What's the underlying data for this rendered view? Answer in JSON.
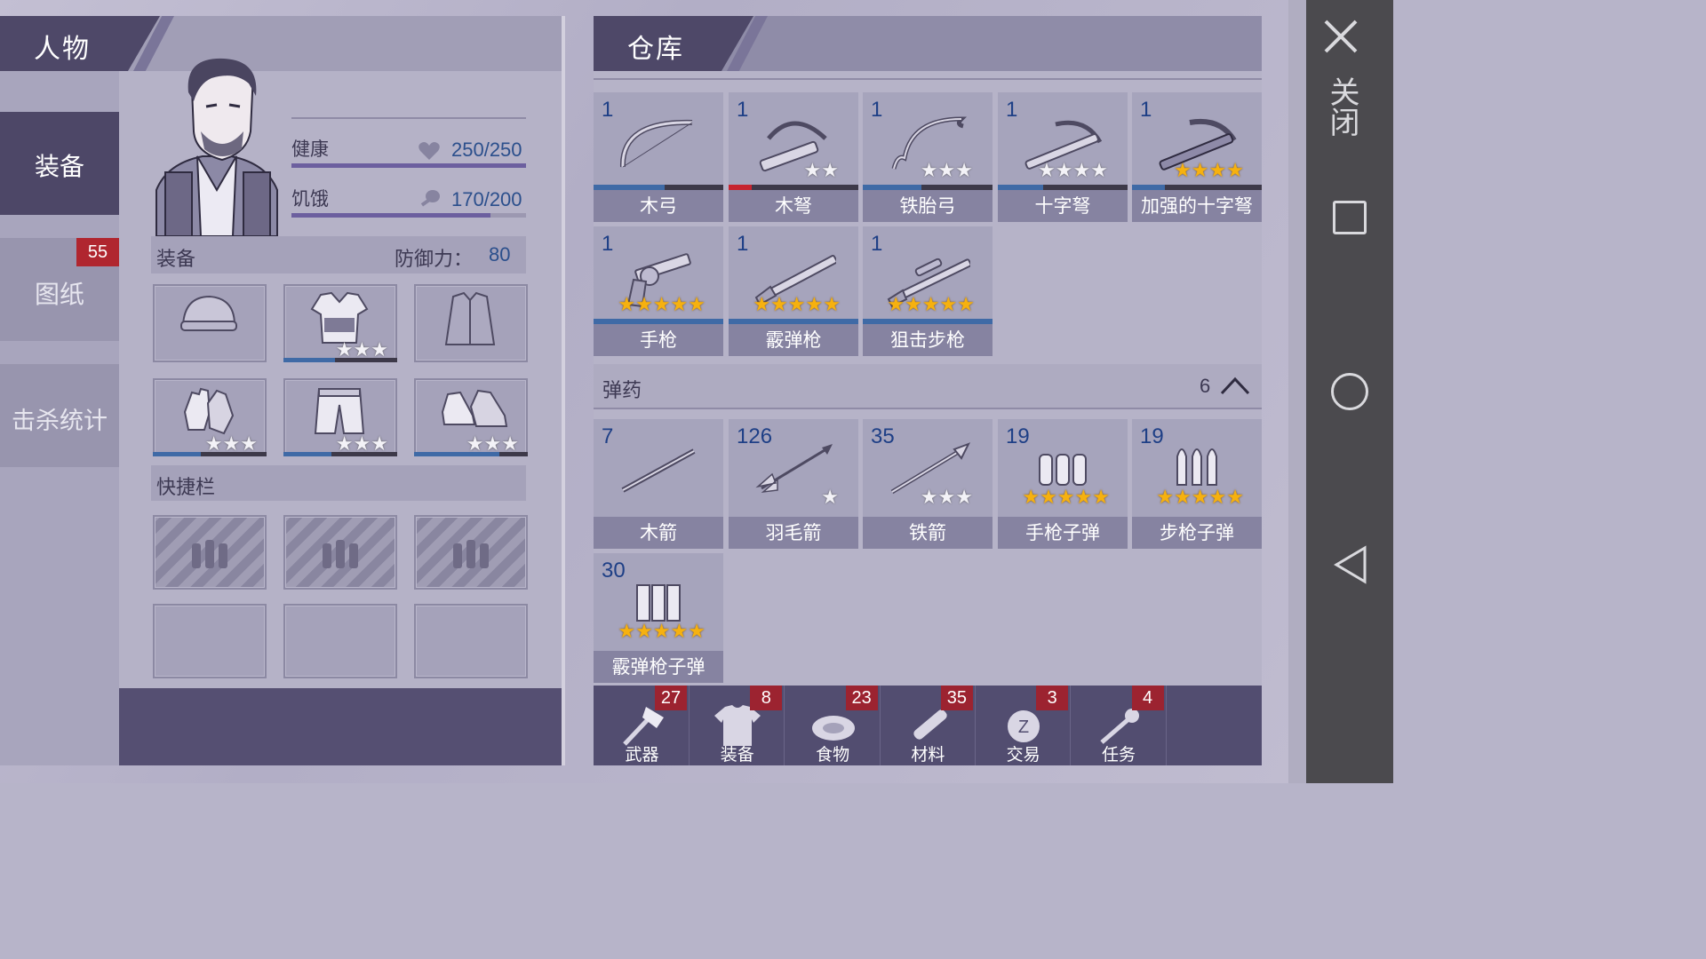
{
  "character_panel": {
    "title": "人物",
    "tabs": [
      {
        "label": "装备"
      },
      {
        "label": "图纸",
        "badge": "55"
      },
      {
        "label": "击杀统计"
      }
    ],
    "stats": {
      "health_label": "健康",
      "health_value": "250/250",
      "health_fraction": 1.0,
      "hunger_label": "饥饿",
      "hunger_value": "170/200",
      "hunger_fraction": 0.85
    },
    "equipment_header": "装备",
    "defense_label": "防御力：",
    "defense_value": "80",
    "equipment_slots": [
      {
        "icon": "beanie-icon",
        "stars": 0,
        "durability": null
      },
      {
        "icon": "vest-shirt-icon",
        "stars": 3,
        "durability": 0.45
      },
      {
        "icon": "jacket-icon",
        "stars": 0,
        "durability": null
      },
      {
        "icon": "gloves-icon",
        "stars": 3,
        "durability": 0.42
      },
      {
        "icon": "shorts-icon",
        "stars": 3,
        "durability": 0.42
      },
      {
        "icon": "sneakers-icon",
        "stars": 3,
        "durability": 0.75
      }
    ],
    "quickbar_header": "快捷栏"
  },
  "storage_panel": {
    "title": "仓库",
    "weapons": [
      {
        "count": "1",
        "name": "木弓",
        "icon": "bow-icon",
        "stars": 0,
        "durability": 0.55,
        "bar_color": "#3f6aa6"
      },
      {
        "count": "1",
        "name": "木弩",
        "icon": "crossbow-icon",
        "stars": 2,
        "durability": 0.18,
        "bar_color": "#c6242f"
      },
      {
        "count": "1",
        "name": "铁胎弓",
        "icon": "recurve-bow-icon",
        "stars": 3,
        "durability": 0.45,
        "bar_color": "#3f6aa6"
      },
      {
        "count": "1",
        "name": "十字弩",
        "icon": "cross-crossbow-icon",
        "stars": 4,
        "durability": 0.35,
        "bar_color": "#3f6aa6"
      },
      {
        "count": "1",
        "name": "加强的十字弩",
        "icon": "reinforced-crossbow-icon",
        "stars": 4,
        "gold": true,
        "durability": 0.25,
        "bar_color": "#3f6aa6"
      },
      {
        "count": "1",
        "name": "手枪",
        "icon": "revolver-icon",
        "stars": 5,
        "gold": true,
        "durability": 1.0,
        "bar_color": "#3f6aa6"
      },
      {
        "count": "1",
        "name": "霰弹枪",
        "icon": "shotgun-icon",
        "stars": 5,
        "gold": true,
        "durability": 1.0,
        "bar_color": "#3f6aa6"
      },
      {
        "count": "1",
        "name": "狙击步枪",
        "icon": "sniper-rifle-icon",
        "stars": 5,
        "gold": true,
        "durability": 1.0,
        "bar_color": "#3f6aa6"
      }
    ],
    "ammo_header": "弹药",
    "ammo_count": "6",
    "ammo": [
      {
        "count": "7",
        "name": "木箭",
        "icon": "wooden-arrow-icon",
        "stars": 0
      },
      {
        "count": "126",
        "name": "羽毛箭",
        "icon": "feather-arrow-icon",
        "stars": 1
      },
      {
        "count": "35",
        "name": "铁箭",
        "icon": "iron-arrow-icon",
        "stars": 3
      },
      {
        "count": "19",
        "name": "手枪子弹",
        "icon": "pistol-bullets-icon",
        "stars": 5,
        "gold": true
      },
      {
        "count": "19",
        "name": "步枪子弹",
        "icon": "rifle-bullets-icon",
        "stars": 5,
        "gold": true
      },
      {
        "count": "30",
        "name": "霰弹枪子弹",
        "icon": "shotgun-shells-icon",
        "stars": 5,
        "gold": true
      }
    ],
    "category_tabs": [
      {
        "label": "武器",
        "badge": "27",
        "icon": "axe-icon"
      },
      {
        "label": "装备",
        "badge": "8",
        "icon": "tshirt-icon"
      },
      {
        "label": "食物",
        "badge": "23",
        "icon": "meat-icon"
      },
      {
        "label": "材料",
        "badge": "35",
        "icon": "wood-log-icon"
      },
      {
        "label": "交易",
        "badge": "3",
        "icon": "coin-icon"
      },
      {
        "label": "任务",
        "badge": "4",
        "icon": "key-icon"
      }
    ]
  },
  "right_bar": {
    "close_label": "关闭"
  },
  "colors": {
    "accent": "#4e4868",
    "badge_red": "#b0262f",
    "count_blue": "#1e3f86",
    "star_gold": "#f6b10f"
  }
}
